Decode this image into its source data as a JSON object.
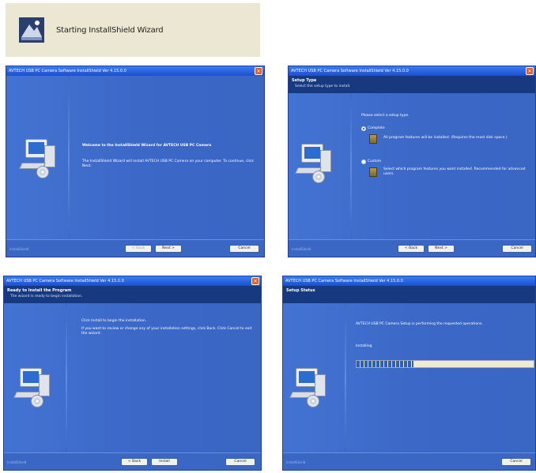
{
  "banner": {
    "text": "Starting InstallShield Wizard",
    "icon": "installer-icon"
  },
  "windows": [
    {
      "title": "AVTECH USB PC Camera Software InstallShield Ver 4.15.0.0",
      "welcome_heading": "Welcome to the InstallShield Wizard for AVTECH USB PC Camera",
      "welcome_body": "The InstallShield Wizard will install AVTECH USB PC Camera on your computer. To continue, click Next.",
      "buttons": {
        "back": "< Back",
        "next": "Next >",
        "cancel": "Cancel"
      },
      "brand": "InstallShield"
    },
    {
      "title": "AVTECH USB PC Camera Software InstallShield Ver 4.15.0.0",
      "header_title": "Setup Type",
      "header_subtitle": "Select the setup type to install.",
      "prompt": "Please select a setup type.",
      "options": [
        {
          "label": "Complete",
          "description": "All program features will be installed. (Requires the most disk space.)",
          "selected": true
        },
        {
          "label": "Custom",
          "description": "Select which program features you want installed. Recommended for advanced users.",
          "selected": false
        }
      ],
      "buttons": {
        "back": "< Back",
        "next": "Next >",
        "cancel": "Cancel"
      },
      "brand": "InstallShield"
    },
    {
      "title": "AVTECH USB PC Camera Software InstallShield Ver 4.15.0.0",
      "header_title": "Ready to Install the Program",
      "header_subtitle": "The wizard is ready to begin installation.",
      "heading": "Click Install to begin the installation.",
      "body": "If you want to review or change any of your installation settings, click Back. Click Cancel to exit the wizard.",
      "buttons": {
        "back": "< Back",
        "install": "Install",
        "cancel": "Cancel"
      },
      "brand": "InstallShield"
    },
    {
      "title": "AVTECH USB PC Camera Software InstallShield Ver 4.15.0.0",
      "header_title": "Setup Status",
      "status": "AVTECH USB PC Camera Setup is performing the requested operations.",
      "progress_label": "Installing",
      "progress": 0.32,
      "buttons": {
        "cancel": "Cancel"
      },
      "brand": "InstallShield"
    }
  ],
  "colors": {
    "dialog_blue": "#3d6ccc",
    "header_navy": "#16397f",
    "titlebar_blue": "#1b4fd0",
    "close_red": "#e35a2c",
    "progress_fill": "#2d5fbf",
    "banner_bg": "#ece7d2"
  }
}
